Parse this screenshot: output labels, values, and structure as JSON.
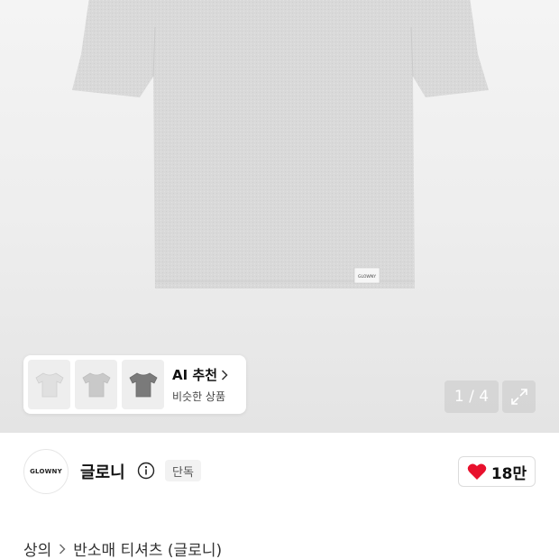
{
  "product": {
    "image_counter": "1 / 4",
    "garment_tag": "GLOWNY"
  },
  "ai_recommend": {
    "title": "AI 추천",
    "subtitle": "비슷한 상품",
    "thumbnail_colors": [
      "#e3e3e3",
      "#cfcfcf",
      "#7d7d7d"
    ]
  },
  "brand": {
    "logo_text": "GLOWNY",
    "name": "글로니",
    "badge": "단독"
  },
  "likes": {
    "count": "18만",
    "heart_color": "#e8112d"
  },
  "breadcrumb": {
    "category": "상의",
    "subcategory": "반소매 티셔츠 (글로니)"
  }
}
